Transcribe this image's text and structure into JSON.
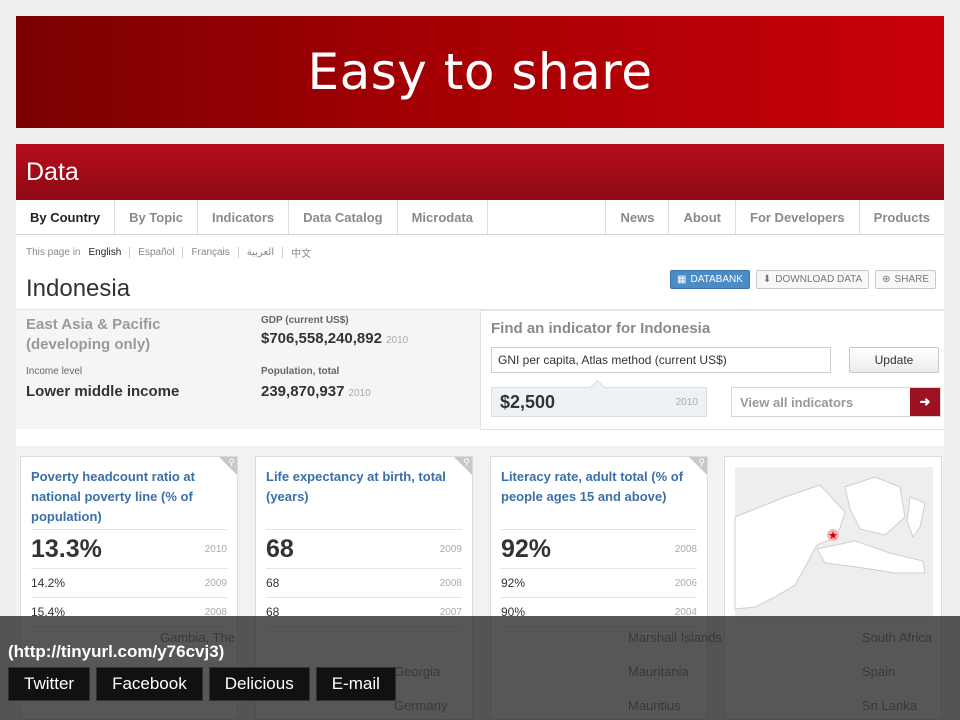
{
  "slide": {
    "title": "Easy to share"
  },
  "site": {
    "section_title": "Data",
    "nav_left": [
      "By Country",
      "By Topic",
      "Indicators",
      "Data Catalog",
      "Microdata"
    ],
    "nav_right": [
      "News",
      "About",
      "For Developers",
      "Products"
    ],
    "languages": {
      "prefix": "This page in",
      "items": [
        "English",
        "Español",
        "Français",
        "العربية",
        "中文"
      ]
    }
  },
  "country": {
    "name": "Indonesia",
    "actions": {
      "databank": "DATABANK",
      "download": "DOWNLOAD DATA",
      "share": "SHARE"
    },
    "region": "East Asia & Pacific (developing only)",
    "income_label": "Income level",
    "income_value": "Lower middle income",
    "gdp_label": "GDP (current US$)",
    "gdp_value": "$706,558,240,892",
    "gdp_year": "2010",
    "pop_label": "Population, total",
    "pop_value": "239,870,937",
    "pop_year": "2010"
  },
  "finder": {
    "title": "Find an indicator for Indonesia",
    "input_value": "GNI per capita, Atlas method (current US$)",
    "update_label": "Update",
    "result_value": "$2,500",
    "result_year": "2010",
    "view_all_label": "View all indicators",
    "arrow": "➜"
  },
  "cards": [
    {
      "title": "Poverty headcount ratio at national poverty line (% of population)",
      "main_value": "13.3%",
      "main_year": "2010",
      "rows": [
        {
          "value": "14.2%",
          "year": "2009"
        },
        {
          "value": "15.4%",
          "year": "2008"
        }
      ]
    },
    {
      "title": "Life expectancy at birth, total (years)",
      "main_value": "68",
      "main_year": "2009",
      "rows": [
        {
          "value": "68",
          "year": "2008"
        },
        {
          "value": "68",
          "year": "2007"
        }
      ]
    },
    {
      "title": "Literacy rate, adult total (% of people ages 15 and above)",
      "main_value": "92%",
      "main_year": "2008",
      "rows": [
        {
          "value": "92%",
          "year": "2006"
        },
        {
          "value": "90%",
          "year": "2004"
        }
      ]
    }
  ],
  "share": {
    "url": "(http://tinyurl.com/y76cvj3)",
    "buttons": [
      "Twitter",
      "Facebook",
      "Delicious",
      "E-mail"
    ]
  },
  "underlay_text": [
    "Gambia, The",
    "Marshall Islands",
    "South Africa",
    "Georgia",
    "Mauritania",
    "Spain",
    "Germany",
    "Mauritius",
    "Sri Lanka"
  ],
  "colors": {
    "banner": "#a40004",
    "header": "#b80c1c",
    "accent_blue": "#4b8bc6",
    "link_blue": "#3b6fa8"
  }
}
